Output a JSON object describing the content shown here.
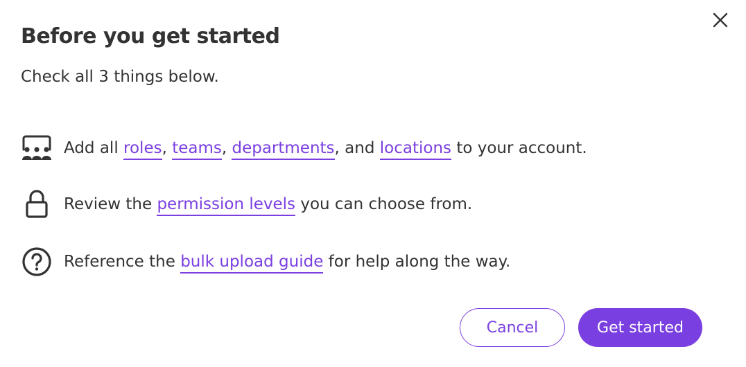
{
  "dialog": {
    "title": "Before you get started",
    "subtitle": "Check all 3 things below.",
    "close_icon": "close-icon"
  },
  "checklist": [
    {
      "icon": "org-structure-icon",
      "prefix": "Add all ",
      "links": [
        "roles",
        "teams",
        "departments",
        "locations"
      ],
      "separators": [
        ", ",
        ", ",
        ", and "
      ],
      "suffix": " to your account."
    },
    {
      "icon": "lock-icon",
      "prefix": "Review the ",
      "link": "permission levels",
      "suffix": " you can choose from."
    },
    {
      "icon": "question-circle-icon",
      "prefix": "Reference the ",
      "link": "bulk upload guide",
      "suffix": " for help along the way."
    }
  ],
  "actions": {
    "cancel_label": "Cancel",
    "start_label": "Get started"
  },
  "colors": {
    "accent": "#7a3fe0",
    "text": "#333333",
    "background": "#ffffff"
  }
}
